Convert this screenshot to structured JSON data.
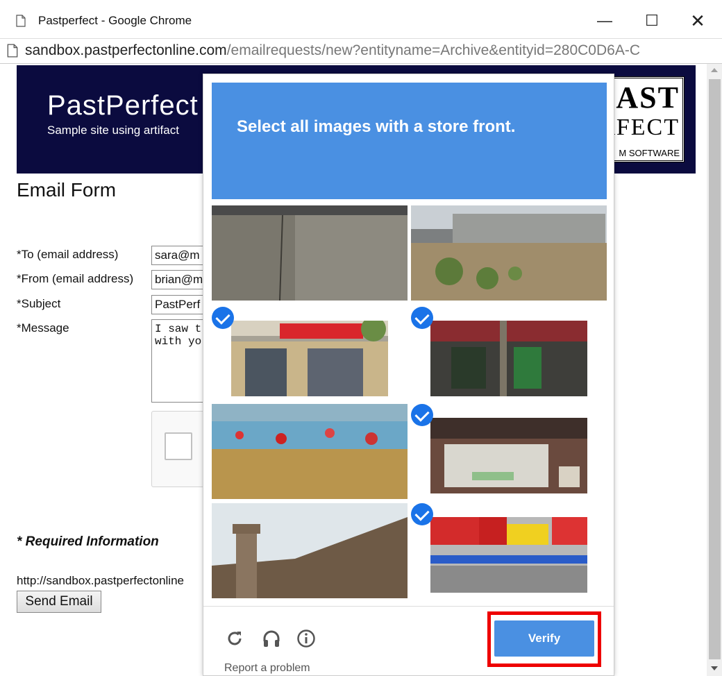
{
  "window": {
    "title": "Pastperfect - Google Chrome",
    "minimize_icon": "minimize-icon",
    "maximize_icon": "maximize-icon",
    "close_icon": "close-icon"
  },
  "address": {
    "host": "sandbox.pastperfectonline.com",
    "path": "/emailrequests/new?entityname=Archive&entityid=280C0D6A-C"
  },
  "banner": {
    "brand": "PastPerfect",
    "tagline": "Sample site using artifact",
    "logo_line1": "AST",
    "logo_line2": "RFECT",
    "logo_line3": "M SOFTWARE"
  },
  "form": {
    "title": "Email Form",
    "to_label": "*To (email address)",
    "to_value": "sara@m",
    "from_label": "*From (email address)",
    "from_value": "brian@m",
    "subject_label": "*Subject",
    "subject_value": "PastPerf",
    "message_label": "*Message",
    "message_value": "I saw t\nwith yo",
    "required_note": "* Required Information",
    "url_line": "http://sandbox.pastperfectonline",
    "send_label": "Send Email"
  },
  "challenge": {
    "prompt_prefix": "Select all images with a ",
    "prompt_bold": "store front.",
    "tiles": [
      {
        "name": "tile-wall-concrete",
        "selected": false
      },
      {
        "name": "tile-warehouse",
        "selected": false
      },
      {
        "name": "tile-store-supermarket",
        "selected": true
      },
      {
        "name": "tile-store-arcade",
        "selected": true
      },
      {
        "name": "tile-mural-fence",
        "selected": false
      },
      {
        "name": "tile-store-trattoria",
        "selected": true
      },
      {
        "name": "tile-castle-wall",
        "selected": false
      },
      {
        "name": "tile-store-signs",
        "selected": true
      }
    ],
    "reload_icon": "reload-icon",
    "audio_icon": "headphones-icon",
    "info_icon": "info-icon",
    "report_label": "Report a problem",
    "verify_label": "Verify",
    "accent": "#4a90e2",
    "highlight": "#e00000"
  }
}
